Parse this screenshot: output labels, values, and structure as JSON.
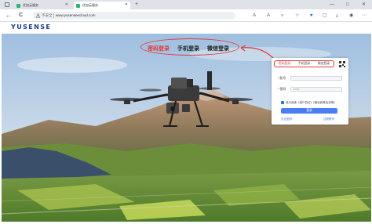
{
  "browser": {
    "tabs": [
      {
        "title": "优加云服务",
        "active": false
      },
      {
        "title": "优加云服务",
        "active": true
      }
    ],
    "new_tab": "+",
    "window_controls": {
      "minimize": "—",
      "restore": "□",
      "close": "✕"
    },
    "back": "←",
    "reload": "C",
    "security_label": "不安全",
    "url": "www.yusenseecloud.com",
    "toolbar_icons": [
      "translate-icon",
      "read-aloud-icon",
      "zoom-icon",
      "favorite-icon",
      "favorites-list-icon",
      "collections-icon",
      "downloads-icon",
      "profile-icon",
      "more-icon"
    ]
  },
  "site": {
    "logo": "YUSENSE"
  },
  "hero": {
    "login_tabs": [
      {
        "label": "密码登录",
        "active": true
      },
      {
        "label": "手机登录",
        "active": false
      },
      {
        "label": "微信登录",
        "active": false
      }
    ]
  },
  "login_card": {
    "tabs": [
      {
        "label": "密码登录",
        "active": true
      },
      {
        "label": "手机登录",
        "active": false
      },
      {
        "label": "微信登录",
        "active": false
      }
    ],
    "username_label": "* 账号",
    "password_label": "* 密码",
    "password_value": "••••••",
    "agreement": "我已阅读《用户协议》《隐私政策及说明》",
    "login_button": "登录",
    "forgot_password": "忘记密码",
    "register": "注册账号"
  },
  "colors": {
    "accent_red": "#e03a3a",
    "button_blue": "#4a7ef0",
    "logo_blue": "#1a3e8a"
  }
}
